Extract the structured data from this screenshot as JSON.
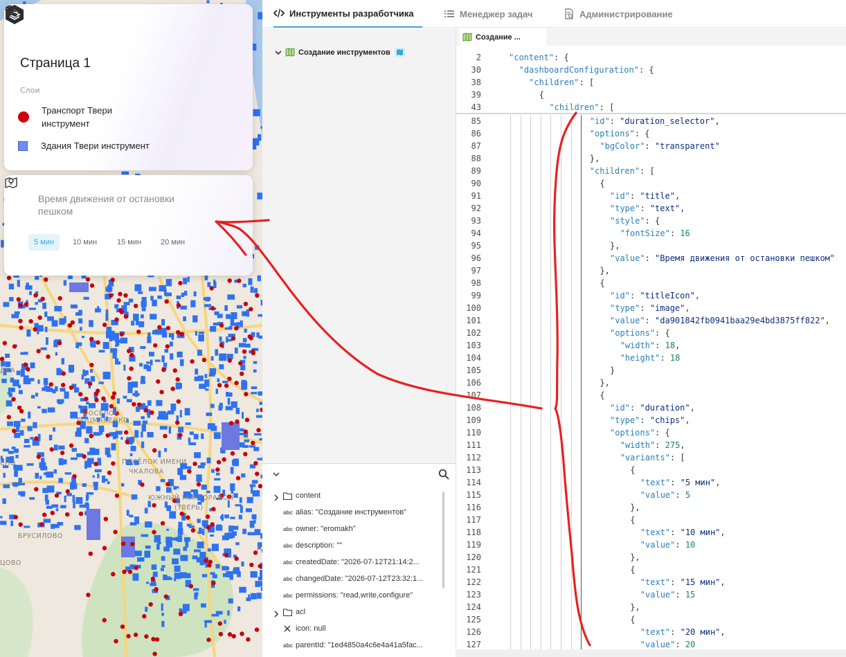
{
  "map_panel": {
    "page_title": "Страница 1",
    "layers_caption": "Слои",
    "layers": [
      {
        "label_line1": "Транспорт Твери",
        "label_line2": "инструмент",
        "color": "#d2000c"
      },
      {
        "label_line1": "Здания Твери инструмент",
        "color": "#6f8cf2"
      }
    ],
    "tool": {
      "title_line1": "Время движения от остановки",
      "title_line2": "пешком",
      "chips": [
        "5 мин",
        "10 мин",
        "15 мин",
        "20 мин"
      ],
      "selected_chip": "5 мин"
    },
    "map_labels": [
      "ПОСЁЛОК",
      "ЛОЦМАНЕНКО",
      "ПОСЁЛОК ИМЕНИ",
      "ЧКАЛОВА",
      "ЮЖНЫЙ МИКРОРАЙОН",
      "(ТВЕРЬ)",
      "БРУСИЛОВО",
      "ЦОВО",
      "СНО",
      "П",
      "ДКА"
    ]
  },
  "top_tabs": [
    {
      "label": "Инструменты разработчика",
      "icon": "code-icon",
      "active": true
    },
    {
      "label": "Менеджер задач",
      "icon": "list-icon",
      "active": false
    },
    {
      "label": "Администрирование",
      "icon": "admin-doc-icon",
      "active": false
    }
  ],
  "tree": {
    "root_label": "Создание инструментов"
  },
  "properties": [
    {
      "kind": "folder",
      "text": "content",
      "expandable": true
    },
    {
      "kind": "abc",
      "text": "alias: \"Создание инструментов\""
    },
    {
      "kind": "abc",
      "text": "owner: \"eromakh\""
    },
    {
      "kind": "abc",
      "text": "description: \"\""
    },
    {
      "kind": "abc",
      "text": "createdDate: \"2026-07-12T21:14:2..."
    },
    {
      "kind": "abc",
      "text": "changedDate: \"2026-07-12T23:32:1..."
    },
    {
      "kind": "abc",
      "text": "permissions: \"read,write,configure\""
    },
    {
      "kind": "folder",
      "text": "acl",
      "expandable": true
    },
    {
      "kind": "null",
      "text": "icon: null"
    },
    {
      "kind": "abc",
      "text": "parentId: \"1ed4850a4c6e4a41a5fac..."
    }
  ],
  "editor": {
    "tab_label": "Создание ...",
    "sticky_lines": [
      {
        "num": "2",
        "indent": 0,
        "tokens": [
          [
            "k",
            "\"content\""
          ],
          [
            "p",
            ": {"
          ]
        ]
      },
      {
        "num": "30",
        "indent": 1,
        "tokens": [
          [
            "k",
            "\"dashboardConfiguration\""
          ],
          [
            "p",
            ": {"
          ]
        ]
      },
      {
        "num": "38",
        "indent": 2,
        "tokens": [
          [
            "k",
            "\"children\""
          ],
          [
            "p",
            ": ["
          ]
        ]
      },
      {
        "num": "39",
        "indent": 3,
        "tokens": [
          [
            "p",
            "{"
          ]
        ]
      },
      {
        "num": "43",
        "indent": 4,
        "tokens": [
          [
            "k",
            "\"children\""
          ],
          [
            "p",
            ": ["
          ]
        ]
      }
    ],
    "lines": [
      {
        "num": "85",
        "indent": 8,
        "tokens": [
          [
            "k",
            "\"id\""
          ],
          [
            "p",
            ": "
          ],
          [
            "s",
            "\"duration_selector\""
          ],
          [
            "p",
            ","
          ]
        ]
      },
      {
        "num": "86",
        "indent": 8,
        "tokens": [
          [
            "k",
            "\"options\""
          ],
          [
            "p",
            ": {"
          ]
        ]
      },
      {
        "num": "87",
        "indent": 9,
        "tokens": [
          [
            "k",
            "\"bgColor\""
          ],
          [
            "p",
            ": "
          ],
          [
            "s",
            "\"transparent\""
          ]
        ]
      },
      {
        "num": "88",
        "indent": 8,
        "tokens": [
          [
            "p",
            "},"
          ]
        ]
      },
      {
        "num": "89",
        "indent": 8,
        "tokens": [
          [
            "k",
            "\"children\""
          ],
          [
            "p",
            ": ["
          ]
        ]
      },
      {
        "num": "90",
        "indent": 9,
        "tokens": [
          [
            "p",
            "{"
          ]
        ]
      },
      {
        "num": "91",
        "indent": 10,
        "tokens": [
          [
            "k",
            "\"id\""
          ],
          [
            "p",
            ": "
          ],
          [
            "s",
            "\"title\""
          ],
          [
            "p",
            ","
          ]
        ]
      },
      {
        "num": "92",
        "indent": 10,
        "tokens": [
          [
            "k",
            "\"type\""
          ],
          [
            "p",
            ": "
          ],
          [
            "s",
            "\"text\""
          ],
          [
            "p",
            ","
          ]
        ]
      },
      {
        "num": "93",
        "indent": 10,
        "tokens": [
          [
            "k",
            "\"style\""
          ],
          [
            "p",
            ": {"
          ]
        ]
      },
      {
        "num": "94",
        "indent": 11,
        "tokens": [
          [
            "k",
            "\"fontSize\""
          ],
          [
            "p",
            ": "
          ],
          [
            "n",
            "16"
          ]
        ]
      },
      {
        "num": "95",
        "indent": 10,
        "tokens": [
          [
            "p",
            "},"
          ]
        ]
      },
      {
        "num": "96",
        "indent": 10,
        "tokens": [
          [
            "k",
            "\"value\""
          ],
          [
            "p",
            ": "
          ],
          [
            "s",
            "\"Время движения от остановки пешком\""
          ]
        ]
      },
      {
        "num": "97",
        "indent": 9,
        "tokens": [
          [
            "p",
            "},"
          ]
        ]
      },
      {
        "num": "98",
        "indent": 9,
        "tokens": [
          [
            "p",
            "{"
          ]
        ]
      },
      {
        "num": "99",
        "indent": 10,
        "tokens": [
          [
            "k",
            "\"id\""
          ],
          [
            "p",
            ": "
          ],
          [
            "s",
            "\"titleIcon\""
          ],
          [
            "p",
            ","
          ]
        ]
      },
      {
        "num": "100",
        "indent": 10,
        "tokens": [
          [
            "k",
            "\"type\""
          ],
          [
            "p",
            ": "
          ],
          [
            "s",
            "\"image\""
          ],
          [
            "p",
            ","
          ]
        ]
      },
      {
        "num": "101",
        "indent": 10,
        "tokens": [
          [
            "k",
            "\"value\""
          ],
          [
            "p",
            ": "
          ],
          [
            "s",
            "\"da901842fb0941baa29e4bd3875ff822\""
          ],
          [
            "p",
            ","
          ]
        ]
      },
      {
        "num": "102",
        "indent": 10,
        "tokens": [
          [
            "k",
            "\"options\""
          ],
          [
            "p",
            ": {"
          ]
        ]
      },
      {
        "num": "103",
        "indent": 11,
        "tokens": [
          [
            "k",
            "\"width\""
          ],
          [
            "p",
            ": "
          ],
          [
            "n",
            "18"
          ],
          [
            "p",
            ","
          ]
        ]
      },
      {
        "num": "104",
        "indent": 11,
        "tokens": [
          [
            "k",
            "\"height\""
          ],
          [
            "p",
            ": "
          ],
          [
            "n",
            "18"
          ]
        ]
      },
      {
        "num": "105",
        "indent": 10,
        "tokens": [
          [
            "p",
            "}"
          ]
        ]
      },
      {
        "num": "106",
        "indent": 9,
        "tokens": [
          [
            "p",
            "},"
          ]
        ]
      },
      {
        "num": "107",
        "indent": 9,
        "tokens": [
          [
            "p",
            "{"
          ]
        ]
      },
      {
        "num": "108",
        "indent": 10,
        "tokens": [
          [
            "k",
            "\"id\""
          ],
          [
            "p",
            ": "
          ],
          [
            "s",
            "\"duration\""
          ],
          [
            "p",
            ","
          ]
        ]
      },
      {
        "num": "109",
        "indent": 10,
        "tokens": [
          [
            "k",
            "\"type\""
          ],
          [
            "p",
            ": "
          ],
          [
            "s",
            "\"chips\""
          ],
          [
            "p",
            ","
          ]
        ]
      },
      {
        "num": "110",
        "indent": 10,
        "tokens": [
          [
            "k",
            "\"options\""
          ],
          [
            "p",
            ": {"
          ]
        ]
      },
      {
        "num": "111",
        "indent": 11,
        "tokens": [
          [
            "k",
            "\"width\""
          ],
          [
            "p",
            ": "
          ],
          [
            "n",
            "275"
          ],
          [
            "p",
            ","
          ]
        ]
      },
      {
        "num": "112",
        "indent": 11,
        "tokens": [
          [
            "k",
            "\"variants\""
          ],
          [
            "p",
            ": ["
          ]
        ]
      },
      {
        "num": "113",
        "indent": 12,
        "tokens": [
          [
            "p",
            "{"
          ]
        ]
      },
      {
        "num": "114",
        "indent": 13,
        "tokens": [
          [
            "k",
            "\"text\""
          ],
          [
            "p",
            ": "
          ],
          [
            "s",
            "\"5 мин\""
          ],
          [
            "p",
            ","
          ]
        ]
      },
      {
        "num": "115",
        "indent": 13,
        "tokens": [
          [
            "k",
            "\"value\""
          ],
          [
            "p",
            ": "
          ],
          [
            "n",
            "5"
          ]
        ]
      },
      {
        "num": "116",
        "indent": 12,
        "tokens": [
          [
            "p",
            "},"
          ]
        ]
      },
      {
        "num": "117",
        "indent": 12,
        "tokens": [
          [
            "p",
            "{"
          ]
        ]
      },
      {
        "num": "118",
        "indent": 13,
        "tokens": [
          [
            "k",
            "\"text\""
          ],
          [
            "p",
            ": "
          ],
          [
            "s",
            "\"10 мин\""
          ],
          [
            "p",
            ","
          ]
        ]
      },
      {
        "num": "119",
        "indent": 13,
        "tokens": [
          [
            "k",
            "\"value\""
          ],
          [
            "p",
            ": "
          ],
          [
            "n",
            "10"
          ]
        ]
      },
      {
        "num": "120",
        "indent": 12,
        "tokens": [
          [
            "p",
            "},"
          ]
        ]
      },
      {
        "num": "121",
        "indent": 12,
        "tokens": [
          [
            "p",
            "{"
          ]
        ]
      },
      {
        "num": "122",
        "indent": 13,
        "tokens": [
          [
            "k",
            "\"text\""
          ],
          [
            "p",
            ": "
          ],
          [
            "s",
            "\"15 мин\""
          ],
          [
            "p",
            ","
          ]
        ]
      },
      {
        "num": "123",
        "indent": 13,
        "tokens": [
          [
            "k",
            "\"value\""
          ],
          [
            "p",
            ": "
          ],
          [
            "n",
            "15"
          ]
        ]
      },
      {
        "num": "124",
        "indent": 12,
        "tokens": [
          [
            "p",
            "},"
          ]
        ]
      },
      {
        "num": "125",
        "indent": 12,
        "tokens": [
          [
            "p",
            "{"
          ]
        ]
      },
      {
        "num": "126",
        "indent": 13,
        "tokens": [
          [
            "k",
            "\"text\""
          ],
          [
            "p",
            ": "
          ],
          [
            "s",
            "\"20 мин\""
          ],
          [
            "p",
            ","
          ]
        ]
      },
      {
        "num": "127",
        "indent": 13,
        "tokens": [
          [
            "k",
            "\"value\""
          ],
          [
            "p",
            ": "
          ],
          [
            "n",
            "20"
          ]
        ]
      }
    ]
  },
  "colors": {
    "accent": "#36a3d9",
    "transport_dot": "#d2000c",
    "building_fill": "#2f72ef",
    "annotation": "#e8201f",
    "json_key": "#2a7fb8",
    "json_string": "#0c2d7d",
    "json_number": "#17855c"
  }
}
